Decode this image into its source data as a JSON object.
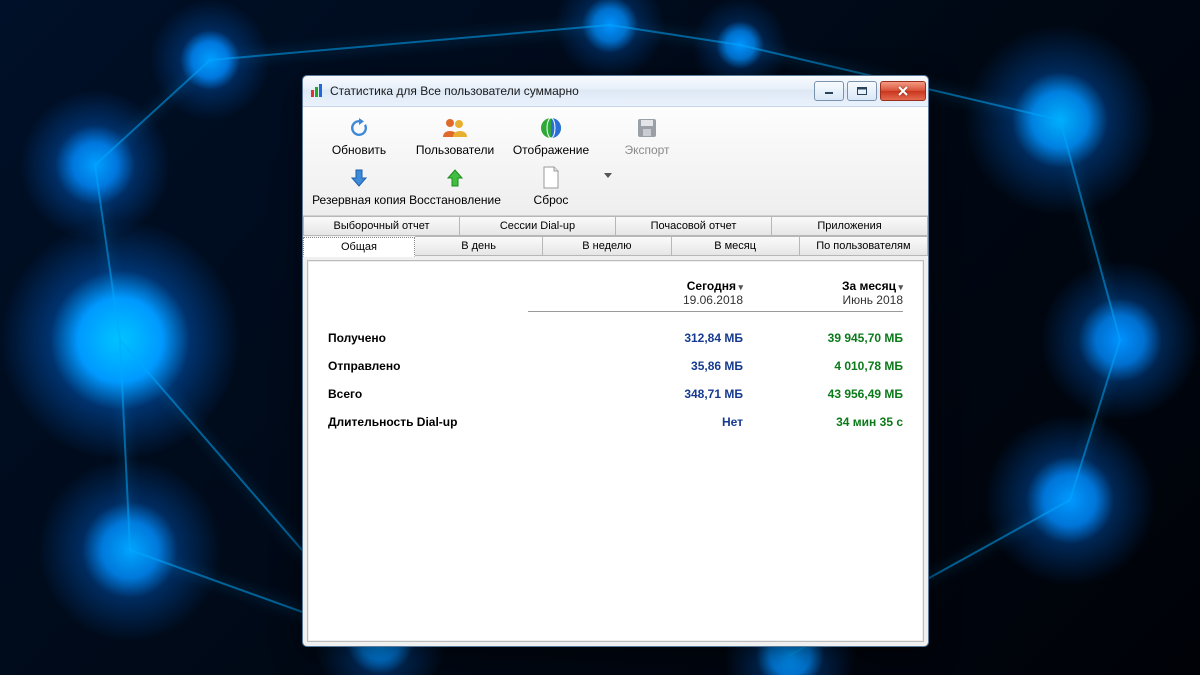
{
  "window": {
    "title": "Статистика для Все пользователи суммарно"
  },
  "toolbar": {
    "row1": {
      "refresh": "Обновить",
      "users": "Пользователи",
      "display": "Отображение",
      "export": "Экспорт"
    },
    "row2": {
      "backup": "Резервная копия",
      "restore": "Восстановление",
      "reset": "Сброс"
    }
  },
  "tabs": {
    "top": [
      "Выборочный отчет",
      "Сессии Dial-up",
      "Почасовой отчет",
      "Приложения"
    ],
    "bottom": [
      "Общая",
      "В день",
      "В неделю",
      "В месяц",
      "По пользователям"
    ],
    "active": "Общая"
  },
  "report": {
    "columns": [
      {
        "title": "Сегодня",
        "subtitle": "19.06.2018"
      },
      {
        "title": "За месяц",
        "subtitle": "Июнь 2018"
      }
    ],
    "rows": [
      {
        "label": "Получено",
        "today": "312,84 МБ",
        "month": "39 945,70 МБ"
      },
      {
        "label": "Отправлено",
        "today": "35,86 МБ",
        "month": "4 010,78 МБ"
      },
      {
        "label": "Всего",
        "today": "348,71 МБ",
        "month": "43 956,49 МБ"
      },
      {
        "label": "Длительность Dial-up",
        "today": "Нет",
        "month": "34 мин 35 с"
      }
    ]
  }
}
